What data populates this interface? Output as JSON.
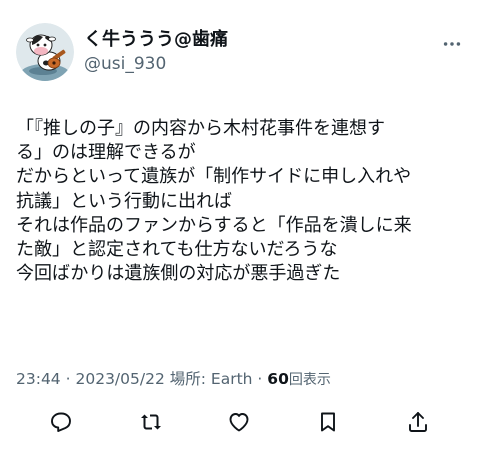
{
  "user": {
    "display_name": "く牛ううう@歯痛",
    "handle": "@usi_930",
    "avatar_icon": "cow-mascot-avatar"
  },
  "tweet": {
    "lines": [
      "「『推しの子』の内容から木村花事件を連想す",
      "る」のは理解できるが",
      "だからといって遺族が「制作サイドに申し入れや",
      "抗議」という行動に出れば",
      "それは作品のファンからすると「作品を潰しに来",
      "た敵」と認定されても仕方ないだろうな",
      "今回ばかりは遺族側の対応が悪手過ぎた"
    ]
  },
  "meta": {
    "time": "23:44",
    "separator": "·",
    "date": "2023/05/22",
    "location_label": "場所: Earth",
    "separator2": "·",
    "views_count": "60",
    "views_label": "回表示"
  },
  "actions": [
    {
      "name": "reply-icon"
    },
    {
      "name": "retweet-icon"
    },
    {
      "name": "like-icon"
    },
    {
      "name": "bookmark-icon"
    },
    {
      "name": "share-icon"
    }
  ],
  "colors": {
    "text": "#0f1419",
    "secondary": "#536471",
    "background": "#ffffff"
  }
}
